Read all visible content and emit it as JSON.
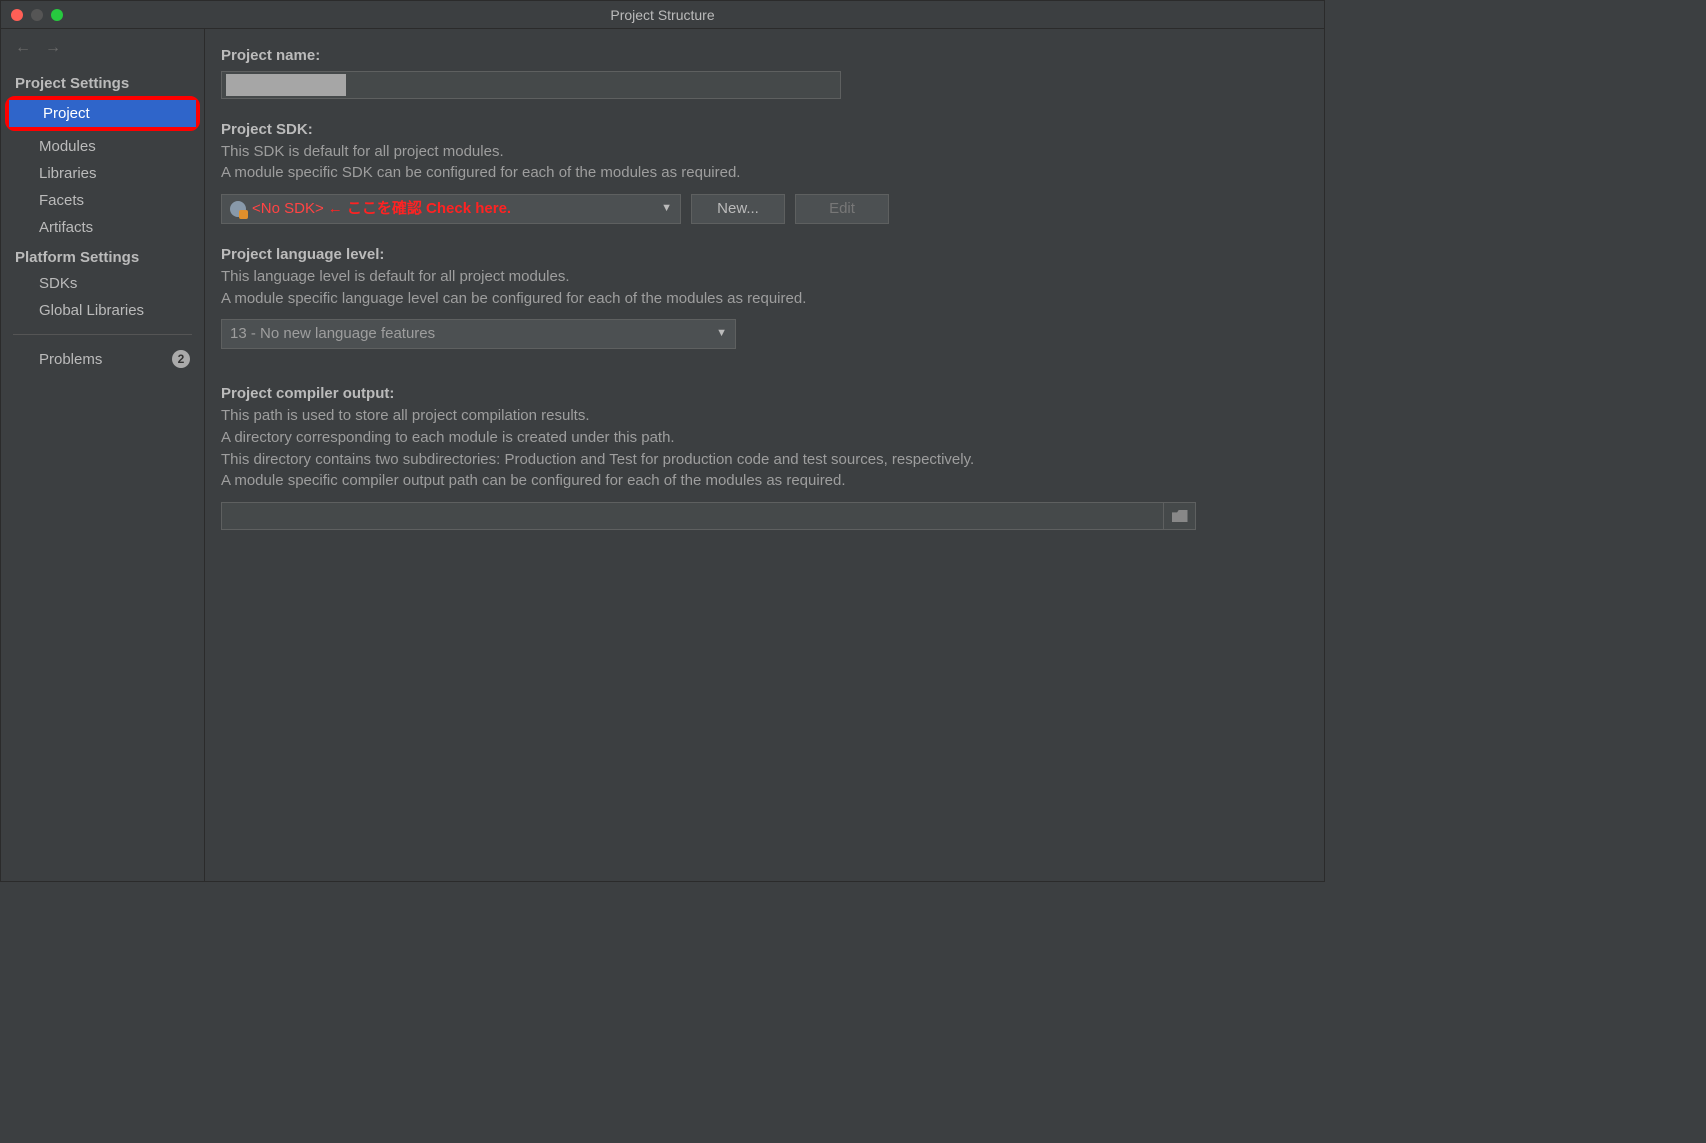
{
  "window": {
    "title": "Project Structure"
  },
  "sidebar": {
    "sections": {
      "project_settings": {
        "title": "Project Settings",
        "items": {
          "project": {
            "label": "Project",
            "selected": true
          },
          "modules": {
            "label": "Modules"
          },
          "libraries": {
            "label": "Libraries"
          },
          "facets": {
            "label": "Facets"
          },
          "artifacts": {
            "label": "Artifacts"
          }
        }
      },
      "platform_settings": {
        "title": "Platform Settings",
        "items": {
          "sdks": {
            "label": "SDKs"
          },
          "global_libraries": {
            "label": "Global Libraries"
          }
        }
      }
    },
    "problems": {
      "label": "Problems",
      "count": "2"
    }
  },
  "main": {
    "project_name": {
      "label": "Project name:",
      "value": ""
    },
    "project_sdk": {
      "label": "Project SDK:",
      "help1": "This SDK is default for all project modules.",
      "help2": "A module specific SDK can be configured for each of the modules as required.",
      "selected": "<No SDK>",
      "annotation": "←  ここを確認 Check here.",
      "new_btn": "New...",
      "edit_btn": "Edit"
    },
    "lang_level": {
      "label": "Project language level:",
      "help1": "This language level is default for all project modules.",
      "help2": "A module specific language level can be configured for each of the modules as required.",
      "selected": "13 - No new language features"
    },
    "compiler_out": {
      "label": "Project compiler output:",
      "help1": "This path is used to store all project compilation results.",
      "help2": "A directory corresponding to each module is created under this path.",
      "help3": "This directory contains two subdirectories: Production and Test for production code and test sources, respectively.",
      "help4": "A module specific compiler output path can be configured for each of the modules as required.",
      "value": ""
    }
  }
}
